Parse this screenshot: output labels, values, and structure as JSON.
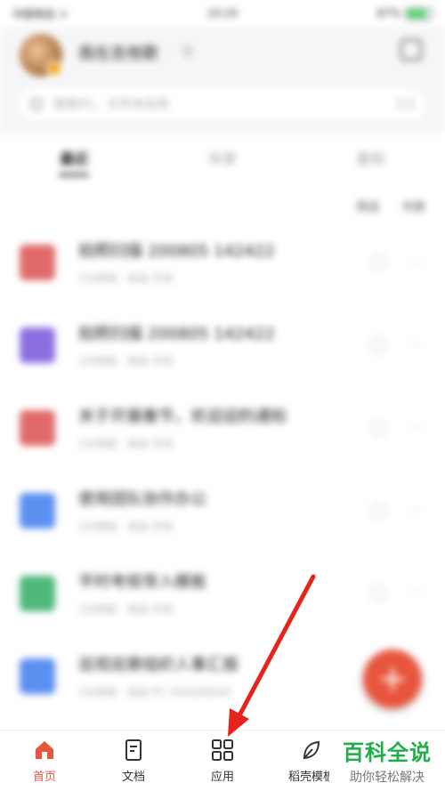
{
  "status_bar": {
    "carrier": "中国电信 ᯤ",
    "time": "10:24",
    "battery": "87%"
  },
  "header": {
    "username": "我在吉他歌",
    "username_tag": "⓪",
    "search_placeholder": "搜索PC、文件夹名称",
    "scan_label": "[-]"
  },
  "tabs": [
    {
      "label": "最近",
      "active": true
    },
    {
      "label": "共享",
      "active": false
    },
    {
      "label": "星标",
      "active": false
    }
  ],
  "sort": {
    "filter_label": "筛选",
    "view_label": "列表"
  },
  "files": [
    {
      "title": "拍照扫描 200805 142422",
      "meta": "2分钟前 · 来自 手机",
      "color": "#e06a6a"
    },
    {
      "title": "拍照扫描 200805 142422",
      "meta": "2分钟前 · 来自 手机",
      "color": "#8b6fe0"
    },
    {
      "title": "关于开展春节，欢迎迎的通知",
      "meta": "2分钟前 · 来自 手机",
      "color": "#e06a6a"
    },
    {
      "title": "使用团队协作办公",
      "meta": "2分钟前 · 来自 手机",
      "color": "#5b8ff0"
    },
    {
      "title": "平时考核导入模板",
      "meta": "2分钟前 · 来自 手机",
      "color": "#4fb87a"
    },
    {
      "title": "巡视巡察组织人事汇报",
      "meta": "2分钟前 · 来自 PC 2020/08/05",
      "color": "#5b8ff0"
    }
  ],
  "fab_label": "+",
  "bottom_nav": [
    {
      "label": "首页",
      "icon": "home-icon",
      "active": true
    },
    {
      "label": "文档",
      "icon": "document-icon",
      "active": false
    },
    {
      "label": "应用",
      "icon": "grid-icon",
      "active": false
    },
    {
      "label": "稻壳模板",
      "icon": "leaf-icon",
      "active": false
    }
  ],
  "watermark": {
    "main": "百科全说",
    "sub": "助你轻松解决"
  },
  "colors": {
    "accent": "#e8553d",
    "arrow": "#e8231e",
    "watermark": "#1fae4a"
  }
}
